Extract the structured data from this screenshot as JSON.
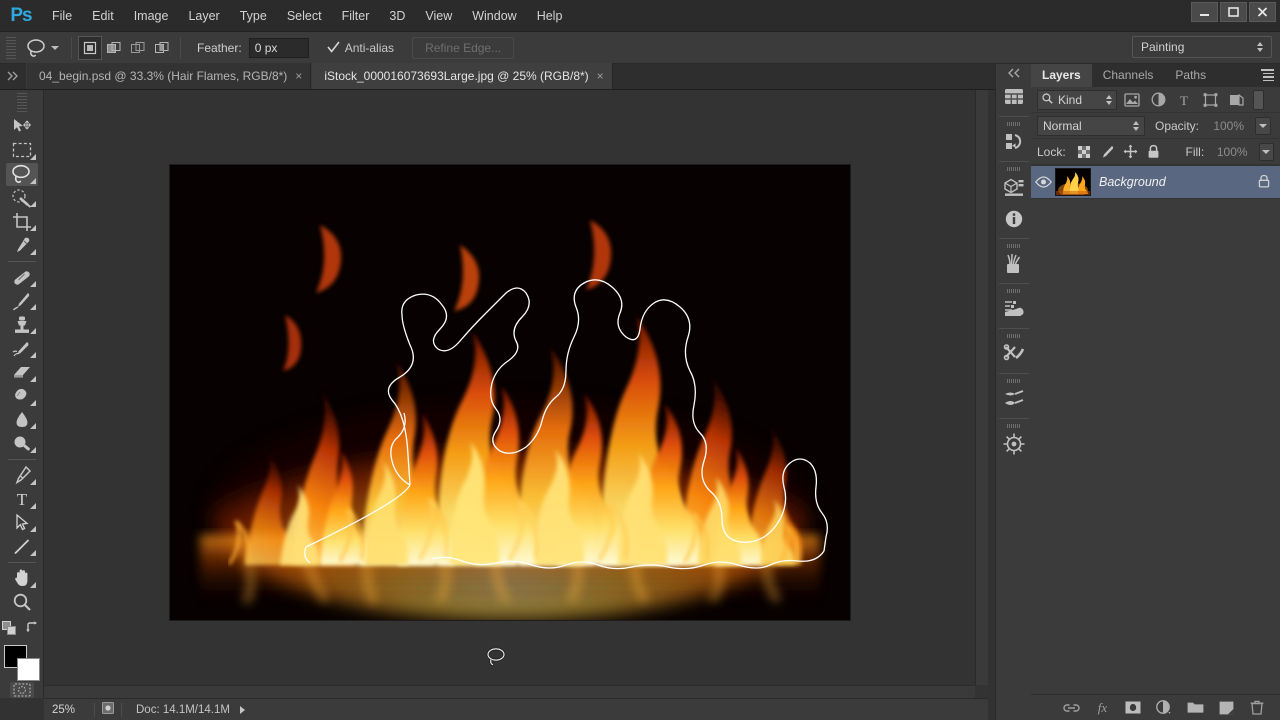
{
  "app": {
    "name": "Adobe Photoshop",
    "logo_text": "Ps",
    "accent": "#2fa8e0"
  },
  "menubar": {
    "items": [
      {
        "label": "File"
      },
      {
        "label": "Edit"
      },
      {
        "label": "Image"
      },
      {
        "label": "Layer"
      },
      {
        "label": "Type"
      },
      {
        "label": "Select"
      },
      {
        "label": "Filter"
      },
      {
        "label": "3D"
      },
      {
        "label": "View"
      },
      {
        "label": "Window"
      },
      {
        "label": "Help"
      }
    ],
    "window_controls": {
      "minimize": "minimize",
      "maximize": "maximize",
      "close": "close"
    }
  },
  "options_bar": {
    "active_tool": "lasso-tool",
    "selection_modes": [
      {
        "name": "new-selection",
        "active": true
      },
      {
        "name": "add-to-selection",
        "active": false
      },
      {
        "name": "subtract-from-selection",
        "active": false
      },
      {
        "name": "intersect-with-selection",
        "active": false
      }
    ],
    "feather_label": "Feather:",
    "feather_value": "0 px",
    "feather_placeholder": "0 px",
    "antialias_label": "Anti-alias",
    "antialias_checked": true,
    "refine_edge_label": "Refine Edge...",
    "refine_edge_enabled": false,
    "workspace": "Painting"
  },
  "tabs": [
    {
      "label": "04_begin.psd @ 33.3% (Hair Flames, RGB/8*)",
      "active": false,
      "close": "×"
    },
    {
      "label": "iStock_000016073693Large.jpg @ 25% (RGB/8*)",
      "active": true,
      "close": "×"
    }
  ],
  "toolbar": {
    "tools": [
      {
        "name": "move-tool",
        "selected": false,
        "has_flyout": false
      },
      {
        "name": "rectangular-marquee-tool",
        "selected": false,
        "has_flyout": true
      },
      {
        "name": "lasso-tool",
        "selected": true,
        "has_flyout": true
      },
      {
        "name": "quick-selection-tool",
        "selected": false,
        "has_flyout": true
      },
      {
        "name": "crop-tool",
        "selected": false,
        "has_flyout": true
      },
      {
        "name": "eyedropper-tool",
        "selected": false,
        "has_flyout": true
      },
      {
        "name": "spot-healing-brush-tool",
        "selected": false,
        "has_flyout": true
      },
      {
        "name": "brush-tool",
        "selected": false,
        "has_flyout": true
      },
      {
        "name": "clone-stamp-tool",
        "selected": false,
        "has_flyout": true
      },
      {
        "name": "history-brush-tool",
        "selected": false,
        "has_flyout": true
      },
      {
        "name": "eraser-tool",
        "selected": false,
        "has_flyout": true
      },
      {
        "name": "gradient-tool",
        "selected": false,
        "has_flyout": true
      },
      {
        "name": "blur-tool",
        "selected": false,
        "has_flyout": true
      },
      {
        "name": "dodge-tool",
        "selected": false,
        "has_flyout": true
      },
      {
        "name": "pen-tool",
        "selected": false,
        "has_flyout": true
      },
      {
        "name": "type-tool",
        "selected": false,
        "has_flyout": true
      },
      {
        "name": "path-selection-tool",
        "selected": false,
        "has_flyout": true
      },
      {
        "name": "line-shape-tool",
        "selected": false,
        "has_flyout": true
      },
      {
        "name": "hand-tool",
        "selected": false,
        "has_flyout": true
      },
      {
        "name": "zoom-tool",
        "selected": false,
        "has_flyout": false
      }
    ],
    "foreground_color": "#000000",
    "background_color": "#ffffff",
    "quick_mask": "edit-in-quick-mask-mode"
  },
  "canvas": {
    "document_title": "iStock_000016073693Large.jpg",
    "background_color": "#333333",
    "image_background": "#060000",
    "selection_active": true,
    "selection_marquee_color": "#ffffff",
    "cursor": "lasso-cursor"
  },
  "status_bar": {
    "zoom_level": "25%",
    "zoom_placeholder": "25%",
    "doc_info": "Doc: 14.1M/14.1M",
    "expand_icon": "play-triangle-icon"
  },
  "icon_dock": {
    "collapse_label": "«",
    "items": [
      {
        "name": "mini-bridge-icon"
      },
      {
        "name": "history-icon"
      },
      {
        "name": "3d-panel-icon"
      },
      {
        "name": "info-icon"
      },
      {
        "name": "brush-presets-icon"
      },
      {
        "name": "brush-panel-icon"
      },
      {
        "name": "tool-presets-icon"
      },
      {
        "name": "clone-source-icon"
      },
      {
        "name": "navigator-icon"
      }
    ]
  },
  "layers_panel": {
    "tabs": [
      {
        "label": "Layers",
        "active": true
      },
      {
        "label": "Channels",
        "active": false
      },
      {
        "label": "Paths",
        "active": false
      }
    ],
    "menu_icon": "panel-menu-icon",
    "filter": {
      "kind_label": "Kind",
      "icons": [
        {
          "name": "filter-pixel-layers-icon"
        },
        {
          "name": "filter-adjustment-layers-icon"
        },
        {
          "name": "filter-type-layers-icon"
        },
        {
          "name": "filter-shape-layers-icon"
        },
        {
          "name": "filter-smart-objects-icon"
        }
      ],
      "toggle": "filter-enable-toggle"
    },
    "blend_mode": "Normal",
    "opacity_label": "Opacity:",
    "opacity_value": "100%",
    "lock_label": "Lock:",
    "lock_icons": [
      {
        "name": "lock-transparent-pixels-icon"
      },
      {
        "name": "lock-image-pixels-icon"
      },
      {
        "name": "lock-position-icon"
      },
      {
        "name": "lock-all-icon"
      }
    ],
    "fill_label": "Fill:",
    "fill_value": "100%",
    "layers": [
      {
        "name": "Background",
        "visible": true,
        "locked": true,
        "selected": true,
        "thumbnail": "fire-thumbnail"
      }
    ],
    "footer_icons": [
      {
        "name": "link-layers-icon"
      },
      {
        "name": "layer-style-fx-icon"
      },
      {
        "name": "add-layer-mask-icon"
      },
      {
        "name": "new-adjustment-layer-icon"
      },
      {
        "name": "new-group-icon"
      },
      {
        "name": "new-layer-icon"
      },
      {
        "name": "delete-layer-icon"
      }
    ]
  }
}
